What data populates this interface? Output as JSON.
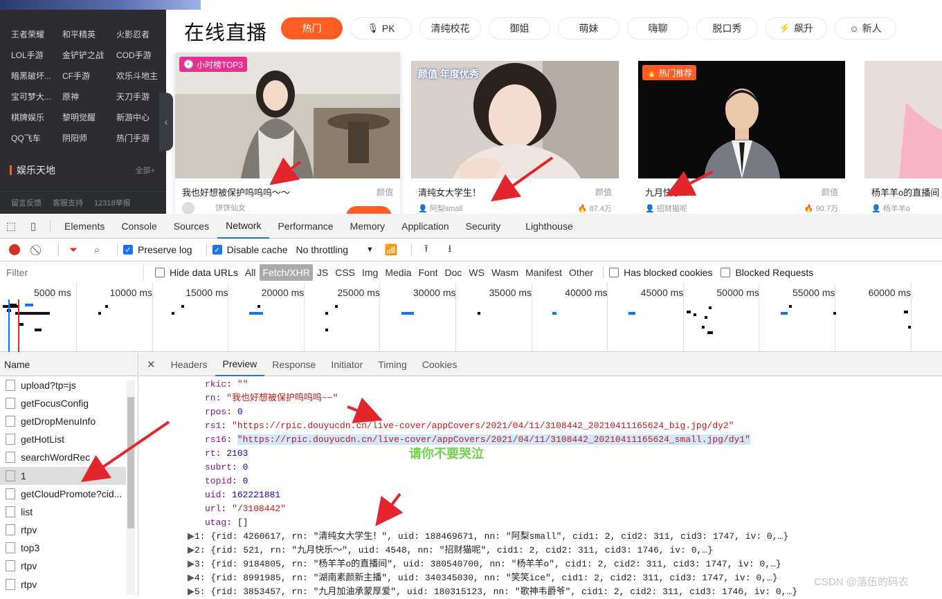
{
  "site": {
    "sidebar": {
      "rows": [
        [
          "王者荣耀",
          "和平精英",
          "火影忍者"
        ],
        [
          "LOL手游",
          "金铲铲之战",
          "COD手游"
        ],
        [
          "暗黑破坏...",
          "CF手游",
          "欢乐斗地主"
        ],
        [
          "宝可梦大...",
          "原神",
          "天刀手游"
        ],
        [
          "棋牌娱乐",
          "黎明觉醒",
          "新游中心"
        ],
        [
          "QQ飞车",
          "阴阳师",
          "热门手游"
        ]
      ],
      "section_title": "娱乐天地",
      "section_all": "全部+",
      "footer": [
        "留言反馈",
        "客服支持",
        "12318举报"
      ]
    },
    "page_title": "在线直播",
    "tags": [
      {
        "label": "热门",
        "icon": "",
        "active": true
      },
      {
        "label": "PK",
        "icon": "mic-icon",
        "active": false
      },
      {
        "label": "清纯校花",
        "icon": "",
        "active": false
      },
      {
        "label": "御姐",
        "icon": "",
        "active": false
      },
      {
        "label": "萌妹",
        "icon": "",
        "active": false
      },
      {
        "label": "嗨聊",
        "icon": "",
        "active": false
      },
      {
        "label": "脱口秀",
        "icon": "",
        "active": false
      },
      {
        "label": "飙升",
        "icon": "bolt-icon",
        "active": false
      },
      {
        "label": "新人",
        "icon": "smile-icon",
        "active": false
      }
    ],
    "cards": [
      {
        "title": "我也好想被保护呜呜呜～～",
        "category": "颜值",
        "user": "饼饼仙女",
        "heat": "",
        "badge": "小时榜TOP3",
        "badge_color": "#e8318f"
      },
      {
        "title": "清纯女大学生！",
        "category": "颜值",
        "user": "阿梨small",
        "heat": "87.4万",
        "badge": "颜值 年度优秀",
        "badge_color": "#2a5bd7"
      },
      {
        "title": "九月快乐～",
        "category": "颜值",
        "user": "招财猫呢",
        "heat": "90.7万",
        "badge": "热门推荐",
        "badge_color": "#ff5d23"
      },
      {
        "title": "杨羊羊o的直播间",
        "category": "",
        "user": "杨羊羊o",
        "heat": "",
        "badge": "",
        "badge_color": ""
      }
    ]
  },
  "devtools": {
    "tabs": [
      "Elements",
      "Console",
      "Sources",
      "Network",
      "Performance",
      "Memory",
      "Application",
      "Security",
      "Lighthouse"
    ],
    "active_tab": "Network",
    "toolbar": {
      "preserve_log": "Preserve log",
      "disable_cache": "Disable cache",
      "throttling": "No throttling"
    },
    "filter": {
      "placeholder": "Filter",
      "hide_data_urls": "Hide data URLs",
      "types": [
        "All",
        "Fetch/XHR",
        "JS",
        "CSS",
        "Img",
        "Media",
        "Font",
        "Doc",
        "WS",
        "Wasm",
        "Manifest",
        "Other"
      ],
      "active_type": "Fetch/XHR",
      "has_blocked_cookies": "Has blocked cookies",
      "blocked_requests": "Blocked Requests"
    },
    "timeline_ticks": [
      "5000 ms",
      "10000 ms",
      "15000 ms",
      "20000 ms",
      "25000 ms",
      "30000 ms",
      "35000 ms",
      "40000 ms",
      "45000 ms",
      "50000 ms",
      "55000 ms",
      "60000 ms"
    ],
    "name_header": "Name",
    "requests": [
      "upload?tp=js",
      "getFocusConfig",
      "getDropMenuInfo",
      "getHotList",
      "searchWordRec",
      "1",
      "getCloudPromote?cid...",
      "list",
      "rtpv",
      "top3",
      "rtpv",
      "rtpv"
    ],
    "selected_request": "1",
    "detail_tabs": [
      "Headers",
      "Preview",
      "Response",
      "Initiator",
      "Timing",
      "Cookies"
    ],
    "active_detail_tab": "Preview",
    "preview_fields": [
      {
        "key": "rkic",
        "value": "\"\"",
        "kind": "string"
      },
      {
        "key": "rn",
        "value": "\"我也好想被保护呜呜呜~~\"",
        "kind": "string"
      },
      {
        "key": "rpos",
        "value": "0",
        "kind": "number"
      },
      {
        "key": "rs1",
        "value": "\"https://rpic.douyucdn.cn/live-cover/appCovers/2021/04/11/3108442_20210411165624_big.jpg/dy2\"",
        "kind": "string"
      },
      {
        "key": "rs16",
        "value": "\"https://rpic.douyucdn.cn/live-cover/appCovers/2021/04/11/3108442_20210411165624_small.jpg/dy1\"",
        "kind": "string"
      },
      {
        "key": "rt",
        "value": "2103",
        "kind": "number"
      },
      {
        "key": "subrt",
        "value": "0",
        "kind": "number"
      },
      {
        "key": "topid",
        "value": "0",
        "kind": "number"
      },
      {
        "key": "uid",
        "value": "162221881",
        "kind": "number"
      },
      {
        "key": "url",
        "value": "\"/3108442\"",
        "kind": "string"
      },
      {
        "key": "utag",
        "value": "[]",
        "kind": "plain"
      }
    ],
    "preview_items": [
      "1: {rid: 4260617, rn: \"清纯女大学生！\", uid: 188469671, nn: \"阿梨small\", cid1: 2, cid2: 311, cid3: 1747, iv: 0,…}",
      "2: {rid: 521, rn: \"九月快乐～\", uid: 4548, nn: \"招财猫呢\", cid1: 2, cid2: 311, cid3: 1746, iv: 0,…}",
      "3: {rid: 9184805, rn: \"杨羊羊o的直播间\", uid: 380540700, nn: \"杨羊羊o\", cid1: 2, cid2: 311, cid3: 1747, iv: 0,…}",
      "4: {rid: 8991985, rn: \"湖南素颜新主播\", uid: 340345030, nn: \"笑笑ice\", cid1: 2, cid2: 311, cid3: 1747, iv: 0,…}",
      "5: {rid: 3853457, rn: \"九月加油承蒙厚爱\", uid: 180315123, nn: \"歌神韦爵爷\", cid1: 2, cid2: 311, cid3: 1746, iv: 0,…}"
    ],
    "annotation": "请你不要哭泣",
    "watermark": "CSDN @落伍的码农"
  }
}
